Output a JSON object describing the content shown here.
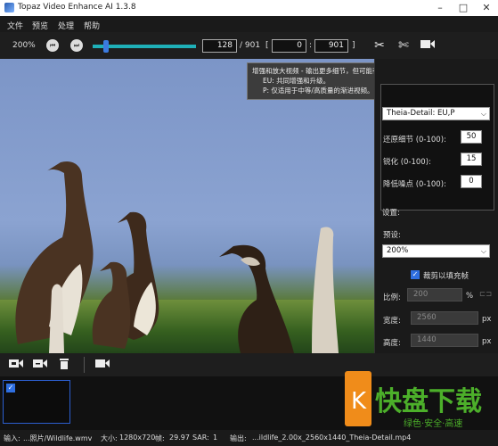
{
  "window": {
    "title": "Topaz Video Enhance AI 1.3.8"
  },
  "menubar": {
    "items": [
      "文件",
      "预览",
      "处理",
      "帮助"
    ]
  },
  "toolbar": {
    "zoom": "200%",
    "current_frame": "128",
    "total_frames": "/ 901",
    "range_start": "0",
    "range_end": "901",
    "range_sep": ":",
    "bracket_open": "[",
    "bracket_close": "]"
  },
  "tooltip": {
    "line1": "增强和放大视频 - 输出更多细节，但可能有瑕疵。",
    "line2": "EU:  共同增强和升级。",
    "line3": "P:  仅适用于中等/高质量的渐进视频。"
  },
  "right_panel": {
    "model_select": "Theia-Detail: EU,P",
    "params": [
      {
        "label": "还原细节 (0-100):",
        "value": "50"
      },
      {
        "label": "锐化 (0-100):",
        "value": "15"
      },
      {
        "label": "降低噪点 (0-100):",
        "value": "0"
      }
    ],
    "settings_title": "设置:",
    "preset_label": "预设:",
    "preset_value": "200%",
    "crop_label": "裁剪以填充帧",
    "scale_label": "比例:",
    "scale_value": "200",
    "scale_unit": "%",
    "width_label": "宽度:",
    "width_value": "2560",
    "height_label": "高度:",
    "height_value": "1440",
    "unit_px": "px"
  },
  "status": {
    "input_label": "输入:",
    "input_value": "...照片/Wildlife.wmv",
    "size_label": "大小:",
    "size_value": "1280x720",
    "fps_label": "帧:",
    "fps_value": "29.97",
    "sar_label": "SAR:",
    "sar_value": "1",
    "output_label": "输出:",
    "output_value": "...ildlife_2.00x_2560x1440_Theia-Detail.mp4"
  },
  "watermark": {
    "brand": "快盘下载",
    "tagline": "绿色·安全·高速"
  },
  "colors": {
    "accent": "#1fb0b8",
    "selection": "#2f6fe0",
    "watermark_green": "#4caf2a",
    "watermark_orange": "#f08c1a"
  }
}
